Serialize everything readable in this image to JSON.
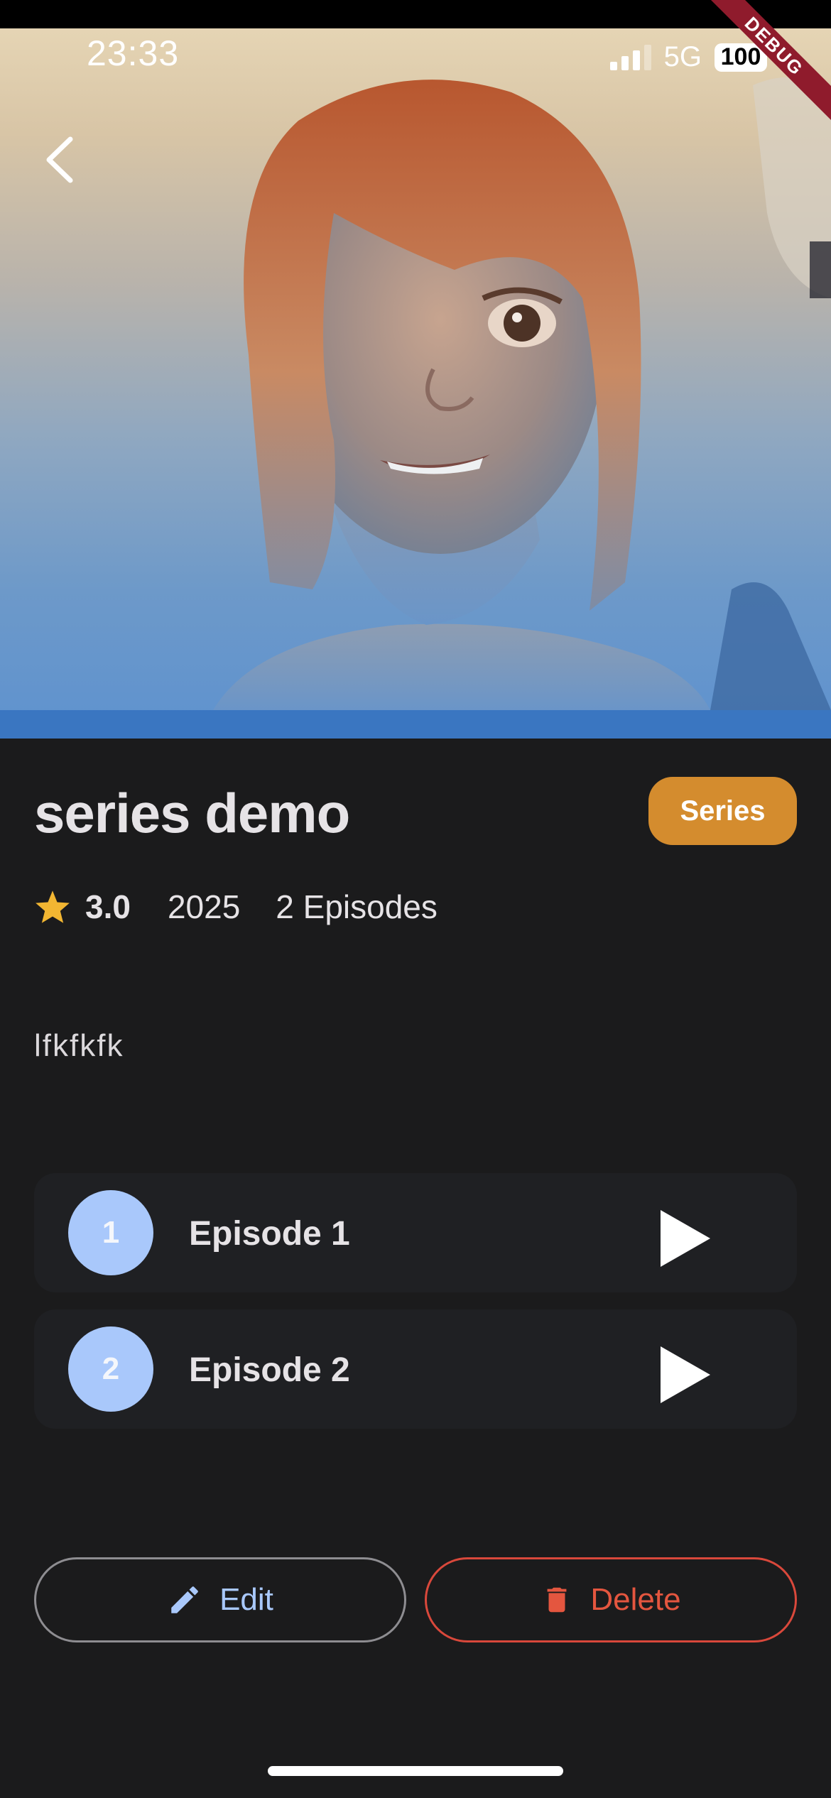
{
  "status_bar": {
    "time": "23:33",
    "network": "5G",
    "battery": "100",
    "debug_label": "DEBUG"
  },
  "navigation": {
    "back_icon": "chevron-left-icon"
  },
  "media": {
    "title": "series demo",
    "type_badge": "Series",
    "rating": "3.0",
    "year": "2025",
    "episode_count": "2 Episodes",
    "description": "lfkfkfk"
  },
  "episodes": [
    {
      "number": "1",
      "title": "Episode 1"
    },
    {
      "number": "2",
      "title": "Episode 2"
    }
  ],
  "actions": {
    "edit_label": "Edit",
    "delete_label": "Delete"
  },
  "colors": {
    "background": "#1b1b1c",
    "badge": "#d48c2e",
    "star": "#f2b632",
    "accent_blue": "#a9c8fb",
    "danger": "#e4563f"
  }
}
